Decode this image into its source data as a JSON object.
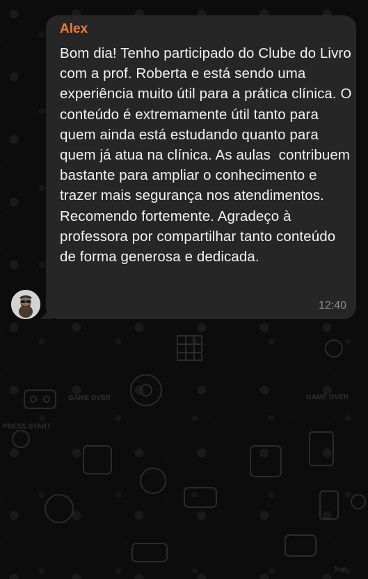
{
  "message": {
    "sender": "Alex",
    "text": "Bom dia! Tenho participado do Clube do Livro com a prof. Roberta e está sendo uma experiência muito útil para a prática clínica. O conteúdo é extremamente útil tanto para quem ainda está estudando quanto para quem já atua na clínica. As aulas  contribuem bastante para ampliar o conhecimento e trazer mais segurança nos atendimentos. Recomendo fortemente. Agradeço à professora por compartilhar tanto conteúdo de forma generosa e dedicada.",
    "time": "12:40"
  },
  "background": {
    "doodles_text": {
      "game_over_left": "GAME OVER",
      "game_over_right": "GAME OVER",
      "press_start": "PRESS START",
      "one_up": "1up"
    }
  },
  "colors": {
    "sender_name": "#f07a3a",
    "bubble": "#262626",
    "background": "#0c0c0c",
    "text": "#f2f2f2",
    "timestamp": "#8e8e8e"
  },
  "icons": [
    "avatar",
    "gamepad-icon",
    "arcade-cabinet-icon",
    "joystick-icon",
    "rubiks-cube-icon"
  ]
}
